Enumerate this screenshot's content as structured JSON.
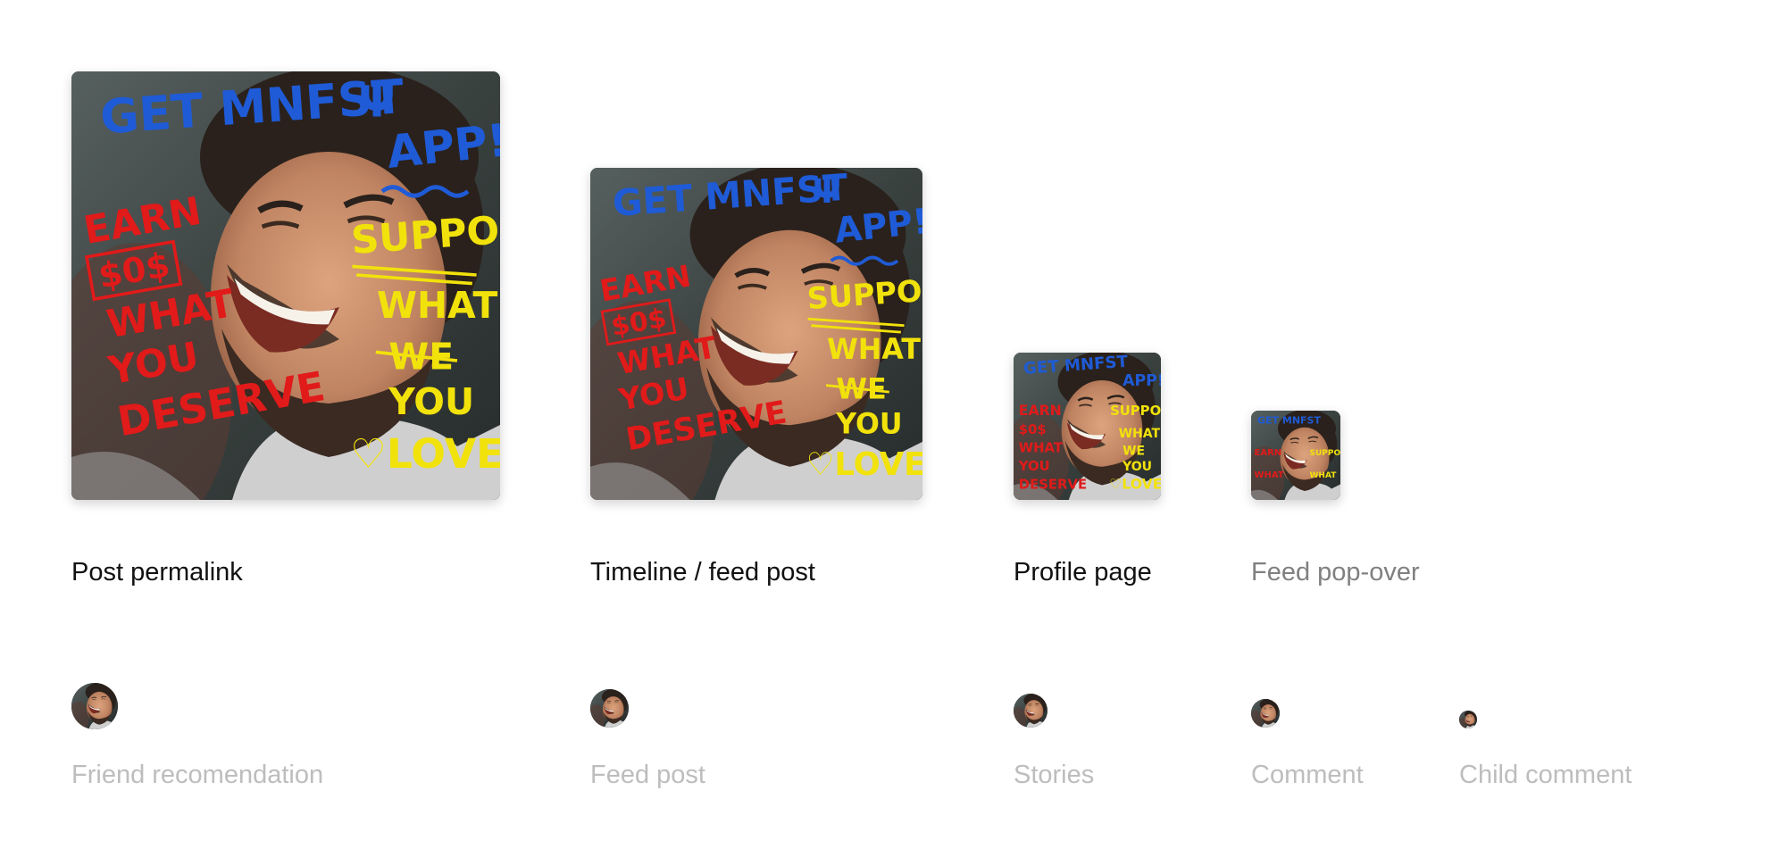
{
  "preview_image": {
    "overlay_text": {
      "top": "GET MNFST",
      "trident": "Ψ",
      "app": "APP!",
      "left_lines": [
        "EARN",
        "$0$",
        "WHAT",
        "YOU",
        "DESERVE"
      ],
      "right_lines": [
        "SUPPORT",
        "WHAT",
        "WE",
        "YOU",
        "♡LOVE."
      ]
    },
    "colors": {
      "blue_text": "#1f5bd6",
      "red_text": "#e11a1a",
      "yellow_text": "#f2e20b",
      "skin": "#c98e68",
      "hair": "#2a211c",
      "shirt": "#d4d4d4",
      "background": "#3b4447"
    }
  },
  "thumbnails": [
    {
      "label": "Post permalink"
    },
    {
      "label": "Timeline / feed post"
    },
    {
      "label": "Profile page"
    },
    {
      "label": "Feed pop-over"
    }
  ],
  "avatars": [
    {
      "label": "Friend recomendation"
    },
    {
      "label": "Feed post"
    },
    {
      "label": "Stories"
    },
    {
      "label": "Comment"
    },
    {
      "label": "Child comment"
    }
  ]
}
